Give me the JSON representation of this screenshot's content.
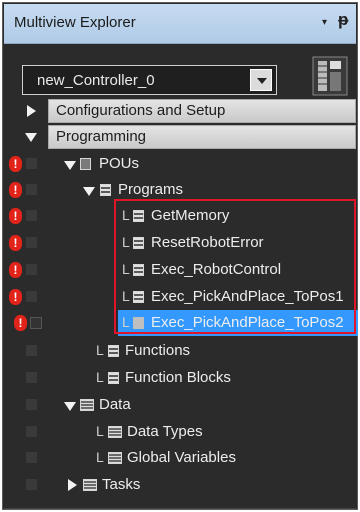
{
  "panel": {
    "title": "Multiview Explorer",
    "pin_arrow": "▾",
    "pin_icon": "ᵽ"
  },
  "controller_select": {
    "value": "new_Controller_0"
  },
  "tree": {
    "configurations": "Configurations and Setup",
    "programming": "Programming",
    "pous": "POUs",
    "programs": "Programs",
    "program_items": [
      "GetMemory",
      "ResetRobotError",
      "Exec_RobotControl",
      "Exec_PickAndPlace_ToPos1",
      "Exec_PickAndPlace_ToPos2"
    ],
    "functions": "Functions",
    "function_blocks": "Function Blocks",
    "data": "Data",
    "data_types": "Data Types",
    "global_variables": "Global Variables",
    "tasks": "Tasks"
  },
  "connector_glyph": "L",
  "error_glyph": "!",
  "colors": {
    "selection": "#3399ff",
    "error": "#e2231a",
    "highlight_border": "#e0152a",
    "panel_bg": "#2b2b2b",
    "titlebar": "#bcd3ee"
  }
}
